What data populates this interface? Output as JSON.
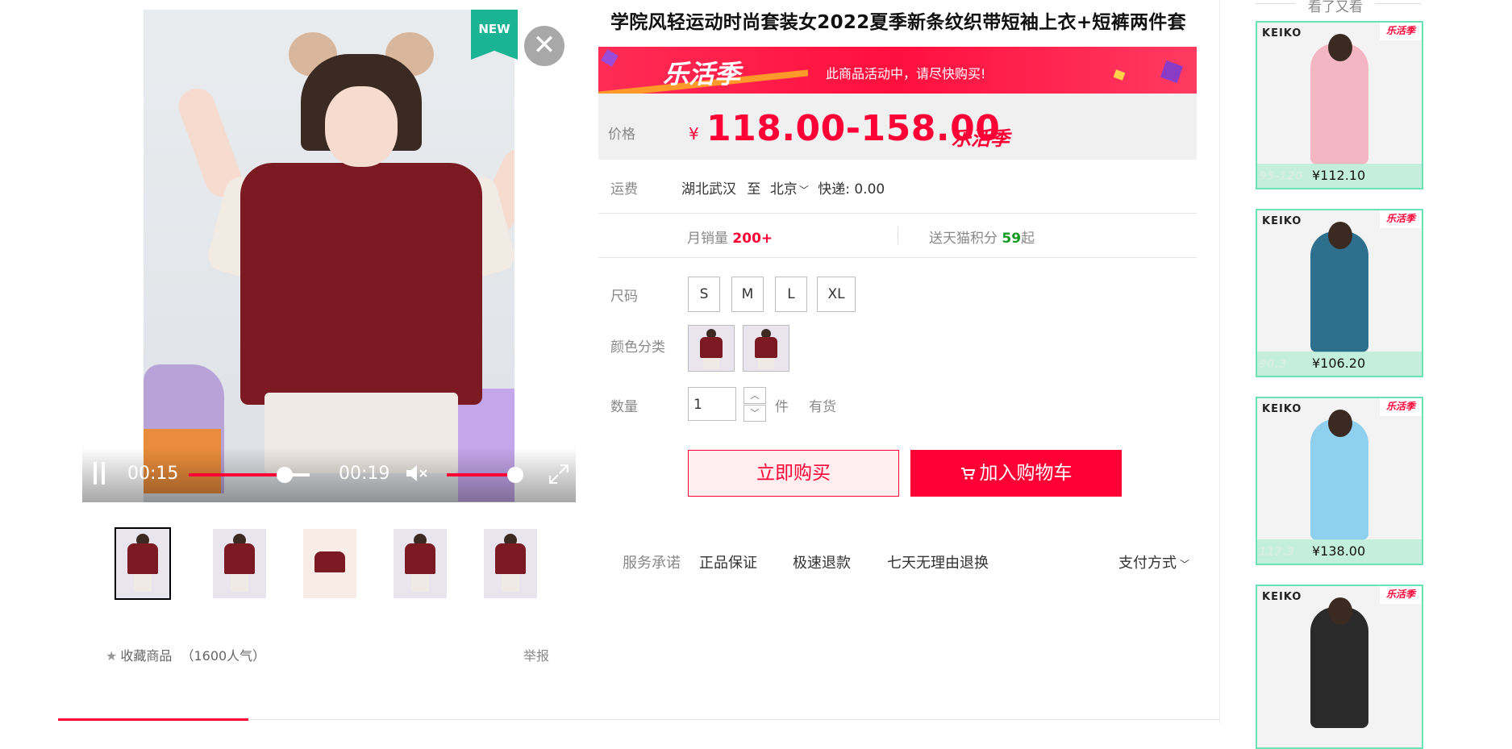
{
  "gallery": {
    "new_badge": "NEW",
    "video": {
      "current_time": "00:15",
      "total_time": "00:19",
      "progress_fraction": 0.79,
      "volume_fraction": 0.9
    },
    "thumbnail_count": 5,
    "favorite_label": "收藏商品",
    "favorite_popularity": "（1600人气）",
    "report_label": "举报"
  },
  "product": {
    "title": "学院风轻运动时尚套装女2022夏季新条纹织带短袖上衣+短裤两件套",
    "promo": {
      "logo": "乐活季",
      "message": "此商品活动中，请尽快购买!"
    },
    "price": {
      "label": "价格",
      "currency": "¥",
      "range": "118.00-158.00",
      "tag": "乐活季"
    },
    "shipping": {
      "label": "运费",
      "origin": "湖北武汉",
      "to": "至",
      "destination": "北京",
      "express": "快递: 0.00"
    },
    "stats": {
      "monthly_sales_label": "月销量",
      "monthly_sales_value": "200+",
      "points_prefix": "送天猫积分",
      "points_value": "59",
      "points_suffix": "起"
    },
    "size": {
      "label": "尺码",
      "options": [
        "S",
        "M",
        "L",
        "XL"
      ]
    },
    "color": {
      "label": "颜色分类",
      "option_count": 2
    },
    "quantity": {
      "label": "数量",
      "value": "1",
      "unit": "件",
      "stock": "有货"
    },
    "buttons": {
      "buy_now": "立即购买",
      "add_to_cart": "加入购物车"
    },
    "service": {
      "label": "服务承诺",
      "items": [
        "正品保证",
        "极速退款",
        "七天无理由退换"
      ],
      "payment": "支付方式"
    }
  },
  "rail": {
    "title": "看了又看",
    "cards": [
      {
        "brand": "KEIKO",
        "corner": "乐活季",
        "price": "¥112.10",
        "size_hint": "95-120",
        "shirt_color": "#f4b6c2"
      },
      {
        "brand": "KEIKO",
        "corner": "乐活季",
        "price": "¥106.20",
        "size_hint": "90.3",
        "shirt_color": "#2e6f8e"
      },
      {
        "brand": "KEIKO",
        "corner": "乐活季",
        "price": "¥138.00",
        "size_hint": "117.3",
        "shirt_color": "#8fd0ef"
      },
      {
        "brand": "KEIKO",
        "corner": "乐活季",
        "price": "",
        "size_hint": "",
        "shirt_color": "#2a2a2a"
      }
    ]
  },
  "colors": {
    "accent": "#ff0036",
    "promo_bg": "#ff1744",
    "new_badge": "#1ab394",
    "rail_border": "#6be3b4"
  }
}
